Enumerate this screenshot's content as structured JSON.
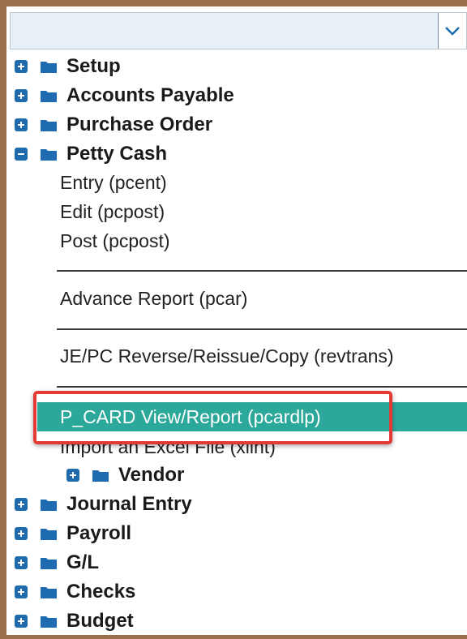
{
  "tree": {
    "top_items": [
      {
        "label": "Setup",
        "state": "collapsed"
      },
      {
        "label": "Accounts Payable",
        "state": "collapsed"
      },
      {
        "label": "Purchase Order",
        "state": "collapsed"
      },
      {
        "label": "Petty Cash",
        "state": "expanded"
      }
    ],
    "petty_cash_children": [
      "Entry (pcent)",
      "Edit (pcpost)",
      "Post (pcpost)",
      "Advance Report (pcar)",
      "JE/PC Reverse/Reissue/Copy (revtrans)",
      "P_CARD View/Report (pcardlp)",
      "Import an Excel File (xlint)"
    ],
    "sub_folder": {
      "label": "Vendor",
      "state": "collapsed"
    },
    "bottom_items": [
      {
        "label": "Journal Entry",
        "state": "collapsed"
      },
      {
        "label": "Payroll",
        "state": "collapsed"
      },
      {
        "label": "G/L",
        "state": "collapsed"
      },
      {
        "label": "Checks",
        "state": "collapsed"
      },
      {
        "label": "Budget",
        "state": "collapsed"
      }
    ]
  },
  "colors": {
    "highlight": "#2ca89a",
    "annotation": "#e53935",
    "expander": "#1f6bb0"
  }
}
